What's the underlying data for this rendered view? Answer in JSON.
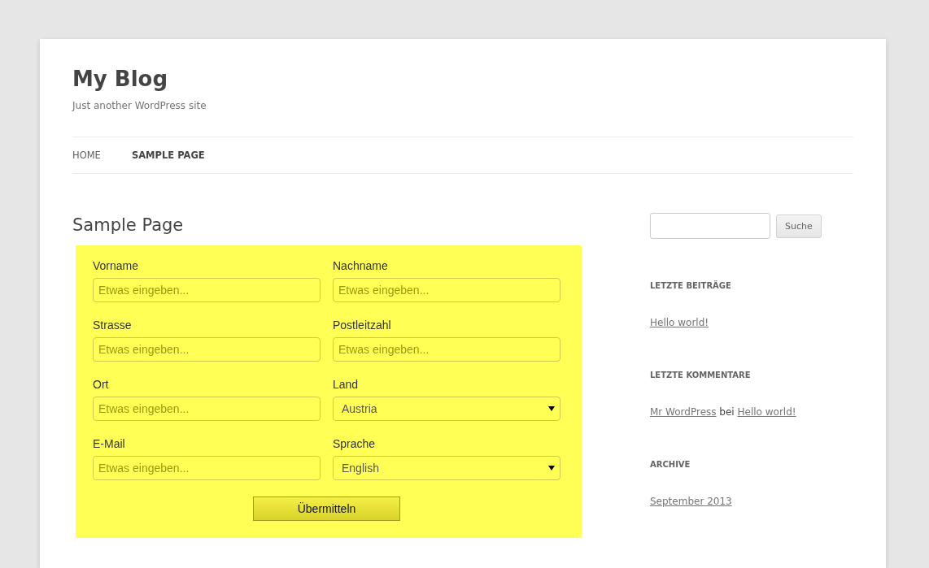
{
  "site": {
    "title": "My Blog",
    "tagline": "Just another WordPress site"
  },
  "nav": [
    {
      "label": "HOME",
      "selected": false
    },
    {
      "label": "SAMPLE PAGE",
      "selected": true
    }
  ],
  "page": {
    "title": "Sample Page",
    "form": {
      "fields": [
        {
          "kind": "text",
          "label": "Vorname",
          "placeholder": "Etwas eingeben..."
        },
        {
          "kind": "text",
          "label": "Nachname",
          "placeholder": "Etwas eingeben..."
        },
        {
          "kind": "text",
          "label": "Strasse",
          "placeholder": "Etwas eingeben..."
        },
        {
          "kind": "text",
          "label": "Postleitzahl",
          "placeholder": "Etwas eingeben..."
        },
        {
          "kind": "text",
          "label": "Ort",
          "placeholder": "Etwas eingeben..."
        },
        {
          "kind": "select",
          "label": "Land",
          "value": "Austria"
        },
        {
          "kind": "text",
          "label": "E-Mail",
          "placeholder": "Etwas eingeben..."
        },
        {
          "kind": "select",
          "label": "Sprache",
          "value": "English"
        }
      ],
      "submit": "Übermitteln"
    }
  },
  "sidebar": {
    "search_button": "Suche",
    "widgets": [
      {
        "title": "LETZTE BEITRÄGE",
        "kind": "links",
        "links": [
          "Hello world!"
        ]
      },
      {
        "title": "LETZTE KOMMENTARE",
        "kind": "comment",
        "author": "Mr WordPress",
        "joiner": "bei",
        "post": "Hello world!"
      },
      {
        "title": "ARCHIVE",
        "kind": "links",
        "links": [
          "September 2013"
        ]
      }
    ]
  }
}
